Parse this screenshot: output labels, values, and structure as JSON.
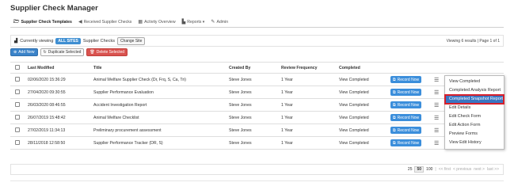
{
  "app": {
    "title": "Supplier Check Manager"
  },
  "nav": {
    "items": [
      {
        "label": "Supplier Check Templates",
        "icon": "folder-icon"
      },
      {
        "label": "Received Supplier Checks",
        "icon": "arrow-icon"
      },
      {
        "label": "Activity Overview",
        "icon": "grid-icon"
      },
      {
        "label": "Reports ▾",
        "icon": "bar-chart-icon"
      },
      {
        "label": "Admin",
        "icon": "wrench-icon"
      }
    ]
  },
  "viewing": {
    "prefix": "Currently viewing",
    "scope": "ALL SITES",
    "suffix": "Supplier Checks",
    "change_label": "Change Site",
    "results": "Viewing 6 results | Page 1 of 1"
  },
  "toolbar": {
    "add_label": "Add New",
    "duplicate_label": "Duplicate Selected",
    "delete_label": "Delete Selected"
  },
  "table": {
    "headers": [
      "Last Modified",
      "Title",
      "Created By",
      "Review Frequency",
      "Completed"
    ],
    "record_label": "Record Now",
    "rows": [
      {
        "modified": "02/06/2020 15:36:29",
        "title": "Animal Welfare Supplier Check (Dr, Frq, S, Ca, Tri)",
        "created_by": "Steve Jones",
        "frequency": "1 Year",
        "completed": "View Completed"
      },
      {
        "modified": "27/04/2020 09:30:55",
        "title": "Supplier Performance Evaluation",
        "created_by": "Steve Jones",
        "frequency": "1 Year",
        "completed": "View Completed"
      },
      {
        "modified": "26/03/2020 08:46:55",
        "title": "Accident Investigation Report",
        "created_by": "Steve Jones",
        "frequency": "1 Year",
        "completed": "View Completed"
      },
      {
        "modified": "26/07/2019 15:48:42",
        "title": "Animal Welfare Checklist",
        "created_by": "Steve Jones",
        "frequency": "1 Year",
        "completed": "View Completed"
      },
      {
        "modified": "27/02/2019 11:34:13",
        "title": "Preliminary procurement assessment",
        "created_by": "Steve Jones",
        "frequency": "1 Year",
        "completed": "View Completed"
      },
      {
        "modified": "28/11/2018 12:58:50",
        "title": "Supplier Performance Tracker (DR, S)",
        "created_by": "Steve Jones",
        "frequency": "1 Year",
        "completed": "View Completed"
      }
    ]
  },
  "dropdown": {
    "items": [
      "View Completed",
      "Completed Analysis Report",
      "Completed Snapshot Report",
      "Edit Details",
      "Edit Check Form",
      "Edit Action Form",
      "Preview Forms",
      "View Edit History"
    ],
    "highlighted_index": 2
  },
  "pager": {
    "sizes": [
      "25",
      "50",
      "100"
    ],
    "selected_size": "50",
    "separator": "|",
    "first": "<< first",
    "previous": "< previous",
    "next": "next >",
    "last": "last >>"
  },
  "colors": {
    "accent": "#3a83c9",
    "danger": "#d9534f",
    "highlight_outline": "#d61f2b"
  }
}
